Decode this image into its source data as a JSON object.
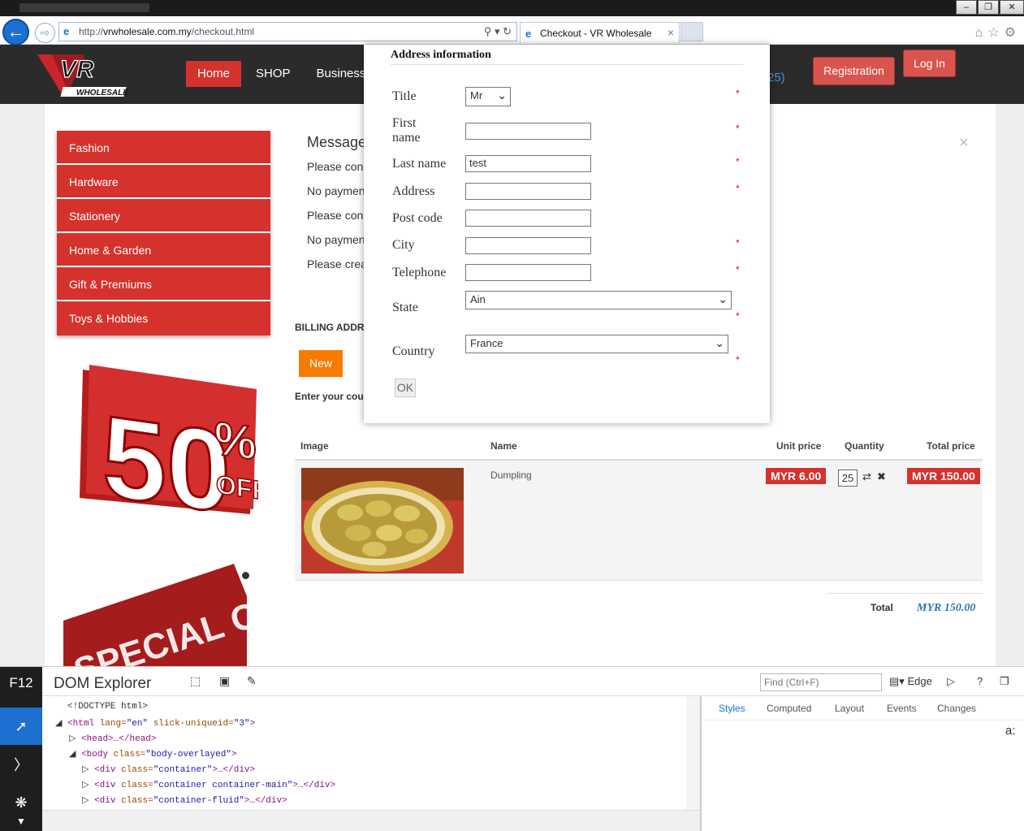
{
  "browser": {
    "url_prefix": "http://",
    "url_host": "vrwholesale.com.my",
    "url_path": "/checkout.html",
    "tab_title": "Checkout - VR Wholesale"
  },
  "header": {
    "menu": [
      "Home",
      "SHOP",
      "Business"
    ],
    "partial_text": "25)",
    "registration": "Registration",
    "login": "Log In"
  },
  "categories": [
    "Fashion",
    "Hardware",
    "Stationery",
    "Home & Garden",
    "Gift & Premiums",
    "Toys & Hobbies"
  ],
  "promos": {
    "big": "50",
    "pct": "%",
    "off": "OFF",
    "special": "SPECIAL OFFER"
  },
  "messages": {
    "title": "Message",
    "lines": [
      "Please con",
      "No paymen",
      "Please con",
      "No paymen",
      "Please crea"
    ]
  },
  "billing": {
    "heading": "BILLING ADDR",
    "new_button": "New",
    "enter_text": "Enter your cou"
  },
  "cart": {
    "columns": {
      "image": "Image",
      "name": "Name",
      "unit_price": "Unit price",
      "quantity": "Quantity",
      "total_price": "Total price"
    },
    "item": {
      "name": "Dumpling",
      "unit_price": "MYR 6.00",
      "quantity": "25",
      "total_price": "MYR 150.00"
    },
    "total_label": "Total",
    "total_value": "MYR 150.00"
  },
  "modal": {
    "title": "Address information",
    "labels": {
      "title": "Title",
      "first_name": "First\nname",
      "last_name": "Last name",
      "address": "Address",
      "post_code": "Post code",
      "city": "City",
      "telephone": "Telephone",
      "state": "State",
      "country": "Country"
    },
    "values": {
      "title": "Mr",
      "first_name": "",
      "last_name": "test",
      "address": "",
      "post_code": "",
      "city": "",
      "telephone": "",
      "state": "Ain",
      "country": "France"
    },
    "required_mark": "*",
    "ok": "OK"
  },
  "devtools": {
    "f12": "F12",
    "title": "DOM Explorer",
    "find_placeholder": "Find (Ctrl+F)",
    "edge": "Edge",
    "tabs": [
      "Styles",
      "Computed",
      "Layout",
      "Events",
      "Changes"
    ],
    "aa": "a:",
    "dom": {
      "doctype": "<!DOCTYPE html>",
      "html_open": "<html",
      "html_lang_attr": " lang=",
      "html_lang_val": "\"en\"",
      "html_slick_attr": " slick-uniqueid=",
      "html_slick_val": "\"3\"",
      "head": "<head>…</head>",
      "body_open": "<body",
      "body_class_attr": " class=",
      "body_class_val": "\"body-overlayed\"",
      "div_open": "<div",
      "div_class_attr": " class=",
      "div1_val": "\"container\"",
      "div2_val": "\"container container-main\"",
      "div3_val": "\"container-fluid\"",
      "div_close": ">…</div>",
      "gt": ">"
    }
  },
  "colors": {
    "brand_red": "#d5322d",
    "orange": "#f57c00",
    "ie_blue": "#1d6fd1",
    "price_blue": "#2a77b2"
  }
}
